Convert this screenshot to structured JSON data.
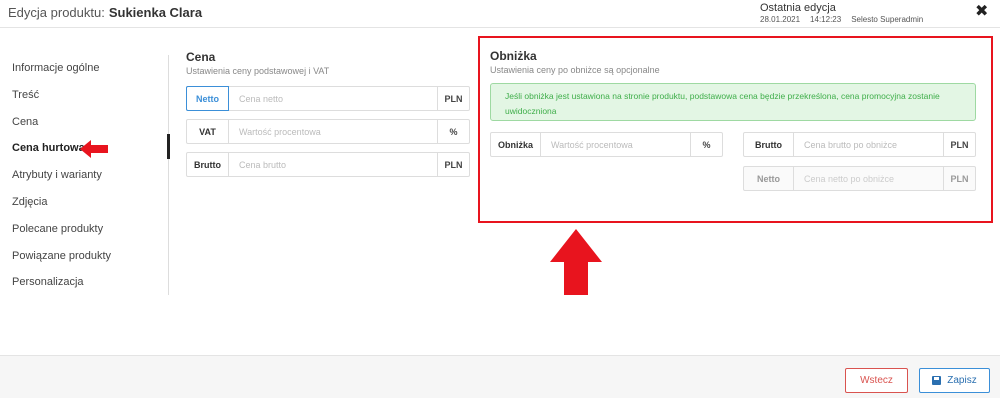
{
  "header": {
    "title_prefix": "Edycja produktu:",
    "product_name": "Sukienka Clara",
    "last_edit_label": "Ostatnia edycja",
    "last_edit_date": "28.01.2021",
    "last_edit_time": "14:12:23",
    "last_edit_user": "Selesto Superadmin",
    "close_icon": "close-icon"
  },
  "sidebar": {
    "items": [
      {
        "label": "Informacje ogólne"
      },
      {
        "label": "Treść"
      },
      {
        "label": "Cena"
      },
      {
        "label": "Cena hurtowa",
        "active": true
      },
      {
        "label": "Atrybuty i warianty"
      },
      {
        "label": "Zdjęcia"
      },
      {
        "label": "Polecane produkty"
      },
      {
        "label": "Powiązane produkty"
      },
      {
        "label": "Personalizacja"
      }
    ]
  },
  "cena": {
    "title": "Cena",
    "subtitle": "Ustawienia ceny podstawowej i VAT",
    "fields": [
      {
        "label": "Netto",
        "placeholder": "Cena netto",
        "unit": "PLN",
        "value": ""
      },
      {
        "label": "VAT",
        "placeholder": "Wartość procentowa",
        "unit": "%",
        "value": ""
      },
      {
        "label": "Brutto",
        "placeholder": "Cena brutto",
        "unit": "PLN",
        "value": ""
      }
    ]
  },
  "obnizka": {
    "title": "Obniżka",
    "subtitle": "Ustawienia ceny po obniżce są opcjonalne",
    "alert": "Jeśli obniżka jest ustawiona na stronie produktu, podstawowa cena będzie przekreślona, cena promocyjna zostanie uwidoczniona",
    "discount": {
      "label": "Obniżka",
      "placeholder": "Wartość procentowa",
      "unit": "%",
      "value": ""
    },
    "brutto": {
      "label": "Brutto",
      "placeholder": "Cena brutto po obniżce",
      "unit": "PLN",
      "value": ""
    },
    "netto": {
      "label": "Netto",
      "placeholder": "Cena netto po obniżce",
      "unit": "PLN",
      "value": ""
    }
  },
  "footer": {
    "back_label": "Wstecz",
    "save_label": "Zapisz"
  },
  "colors": {
    "accent_blue": "#3b8fd8",
    "annotation_red": "#e8141e",
    "alert_green": "#3fae4a",
    "back_red": "#d9534f"
  }
}
